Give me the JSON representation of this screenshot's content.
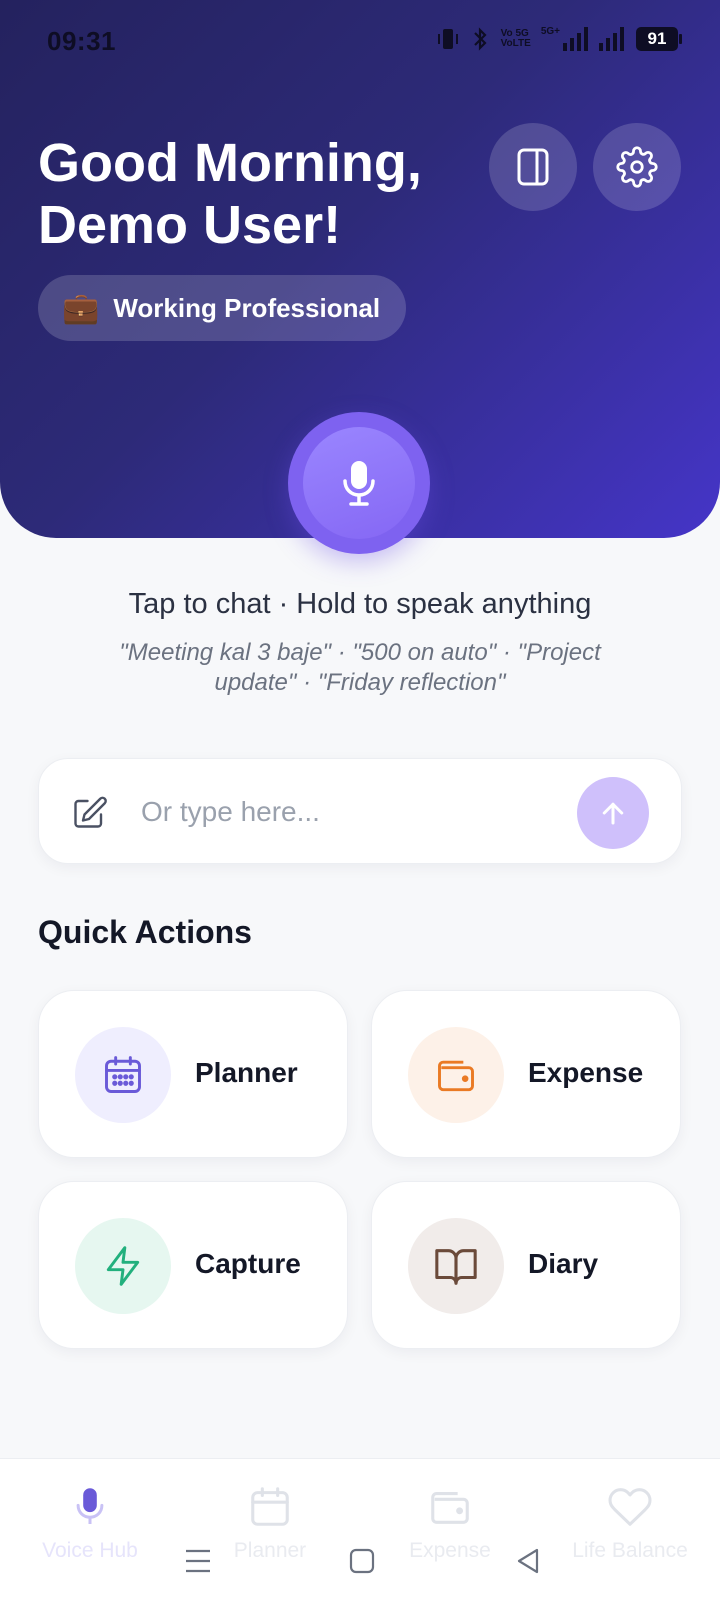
{
  "status_bar": {
    "time": "09:31",
    "network_small_1": "Vo 5G",
    "network_small_2": "VoLTE",
    "network_5g": "5G+",
    "battery": "91"
  },
  "header": {
    "greeting_line1": "Good Morning,",
    "greeting_line2": "Demo User!",
    "role_emoji": "💼",
    "role_label": "Working Professional",
    "sidebar_icon": "sidebar-panel-icon",
    "settings_icon": "gear-icon"
  },
  "voice": {
    "mic_icon": "microphone-icon",
    "hint_title": "Tap to chat · Hold to speak anything",
    "hint_examples": "\"Meeting kal 3 baje\" · \"500 on auto\" · \"Project update\" · \"Friday reflection\""
  },
  "input": {
    "placeholder": "Or type here...",
    "value": ""
  },
  "quick_actions": {
    "title": "Quick Actions",
    "items": [
      {
        "label": "Planner",
        "icon": "calendar-icon",
        "color": "#6a5ad8",
        "bg": "#efeefe"
      },
      {
        "label": "Expense",
        "icon": "wallet-icon",
        "color": "#ea7a24",
        "bg": "#fdf1e8"
      },
      {
        "label": "Capture",
        "icon": "lightning-icon",
        "color": "#22b07d",
        "bg": "#e6f7f0"
      },
      {
        "label": "Diary",
        "icon": "book-icon",
        "color": "#6b4a3a",
        "bg": "#f1ecea"
      }
    ]
  },
  "bottom_nav": {
    "items": [
      {
        "label": "Voice Hub",
        "icon": "microphone-icon",
        "active": true
      },
      {
        "label": "Planner",
        "icon": "calendar-icon",
        "active": false
      },
      {
        "label": "Expense",
        "icon": "wallet-icon",
        "active": false
      },
      {
        "label": "Life Balance",
        "icon": "heart-icon",
        "active": false
      }
    ]
  },
  "colors": {
    "header_start": "#24225e",
    "header_end": "#4535c8",
    "accent": "#7e62f0",
    "send_button": "#cfc0fb"
  }
}
